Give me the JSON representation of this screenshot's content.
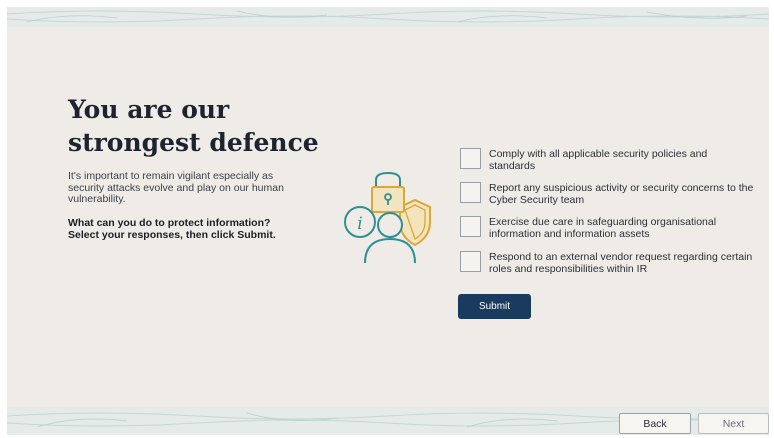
{
  "heading": {
    "line1": "You are our",
    "line2": "strongest defence"
  },
  "intro": "It's important to remain vigilant especially as security attacks evolve and play on our human vulnerability.",
  "question": "What can you do to protect information? Select your responses, then click Submit.",
  "options": [
    {
      "label": "Comply with all applicable security policies and standards",
      "checked": false
    },
    {
      "label": "Report any suspicious activity or security concerns to the Cyber Security team",
      "checked": false
    },
    {
      "label": "Exercise due care in safeguarding organisational information and information assets",
      "checked": false
    },
    {
      "label": "Respond to an external vendor request regarding certain roles and responsibilities within IR",
      "checked": false
    }
  ],
  "submit_label": "Submit",
  "nav": {
    "back_label": "Back",
    "next_label": "Next"
  },
  "illustration": {
    "icons": [
      "padlock-icon",
      "info-icon",
      "person-icon",
      "shield-icon"
    ]
  },
  "colors": {
    "accent": "#1a3a5e",
    "teal": "#2f8f93",
    "gold": "#d9a73a",
    "background": "#efece7"
  }
}
